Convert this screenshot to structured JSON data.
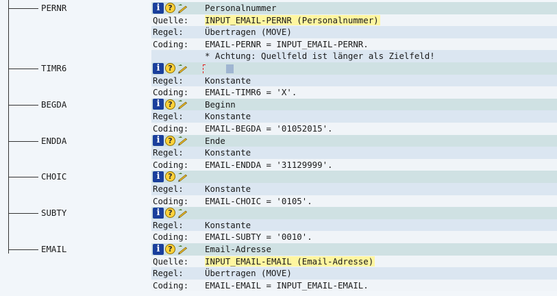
{
  "labels": {
    "quelle": "Quelle:",
    "regel": "Regel:",
    "coding": "Coding:"
  },
  "nodes": [
    {
      "name": "PERNR",
      "header_text": "Personalnummer",
      "quelle": "INPUT_EMAIL-PERNR (Personalnummer)",
      "regel": "Übertragen (MOVE)",
      "coding": "EMAIL-PERNR = INPUT_EMAIL-PERNR.",
      "note": "* Achtung: Quellfeld ist länger als Zielfeld!"
    },
    {
      "name": "TIMR6",
      "header_text": "",
      "regel": "Konstante",
      "coding": "EMAIL-TIMR6 = 'X'."
    },
    {
      "name": "BEGDA",
      "header_text": "Beginn",
      "regel": "Konstante",
      "coding": "EMAIL-BEGDA = '01052015'."
    },
    {
      "name": "ENDDA",
      "header_text": "Ende",
      "regel": "Konstante",
      "coding": "EMAIL-ENDDA = '31129999'."
    },
    {
      "name": "CHOIC",
      "header_text": "",
      "regel": "Konstante",
      "coding": "EMAIL-CHOIC = '0105'."
    },
    {
      "name": "SUBTY",
      "header_text": "",
      "regel": "Konstante",
      "coding": "EMAIL-SUBTY = '0010'."
    },
    {
      "name": "EMAIL",
      "header_text": "Email-Adresse",
      "quelle": "INPUT_EMAIL-EMAIL (Email-Adresse)",
      "regel": "Übertragen (MOVE)",
      "coding": "EMAIL-EMAIL = INPUT_EMAIL-EMAIL."
    }
  ],
  "icons": {
    "info": "info-icon",
    "help": "help-icon",
    "edit": "edit-pencil-icon"
  },
  "colors": {
    "node_header_bg": "#cfe1e3",
    "row_alt_bg": "#dbe6f1",
    "quelle_highlight": "#fff6a0",
    "info_icon": "#1a3f9c",
    "help_icon": "#ffd23a",
    "cursor_red": "#e02020"
  }
}
